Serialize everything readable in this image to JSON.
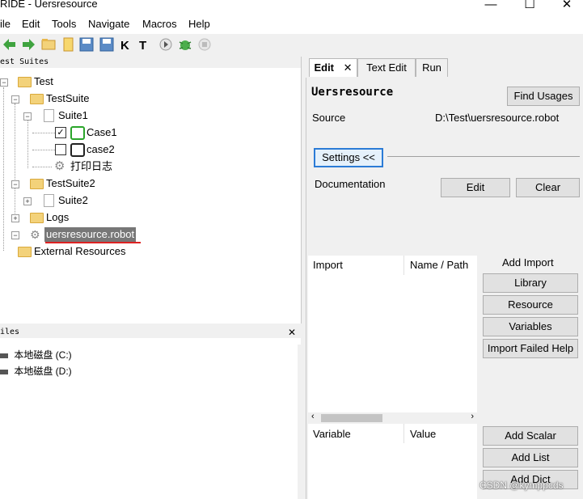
{
  "window": {
    "title": "RIDE - Uersresource"
  },
  "menu": {
    "file": "ile",
    "edit": "Edit",
    "tools": "Tools",
    "navigate": "Navigate",
    "macros": "Macros",
    "help": "Help"
  },
  "tree": {
    "header": "est Suites",
    "items": {
      "test": "Test",
      "testsuite": "TestSuite",
      "suite1": "Suite1",
      "case1": "Case1",
      "case2": "case2",
      "log_keyword": "打印日志",
      "testsuite2": "TestSuite2",
      "suite2": "Suite2",
      "logs": "Logs",
      "resource": "uersresource.robot",
      "external": "External Resources"
    }
  },
  "files": {
    "header": "iles",
    "drives": [
      "本地磁盘 (C:)",
      "本地磁盘 (D:)"
    ]
  },
  "tabs": {
    "edit": "Edit",
    "text_edit": "Text Edit",
    "run": "Run"
  },
  "editor": {
    "title": "Uersresource",
    "find_usages": "Find Usages",
    "source_label": "Source",
    "source_value": "D:\\Test\\uersresource.robot",
    "settings": "Settings <<",
    "documentation": "Documentation",
    "edit_btn": "Edit",
    "clear_btn": "Clear",
    "import_cols": [
      "Import",
      "Name / Path"
    ],
    "add_import": "Add Import",
    "import_buttons": [
      "Library",
      "Resource",
      "Variables",
      "Import Failed Help"
    ],
    "variable_cols": [
      "Variable",
      "Value"
    ],
    "variable_buttons": [
      "Add Scalar",
      "Add List",
      "Add Dict"
    ]
  },
  "watermark": "CSDN @kymppcds"
}
